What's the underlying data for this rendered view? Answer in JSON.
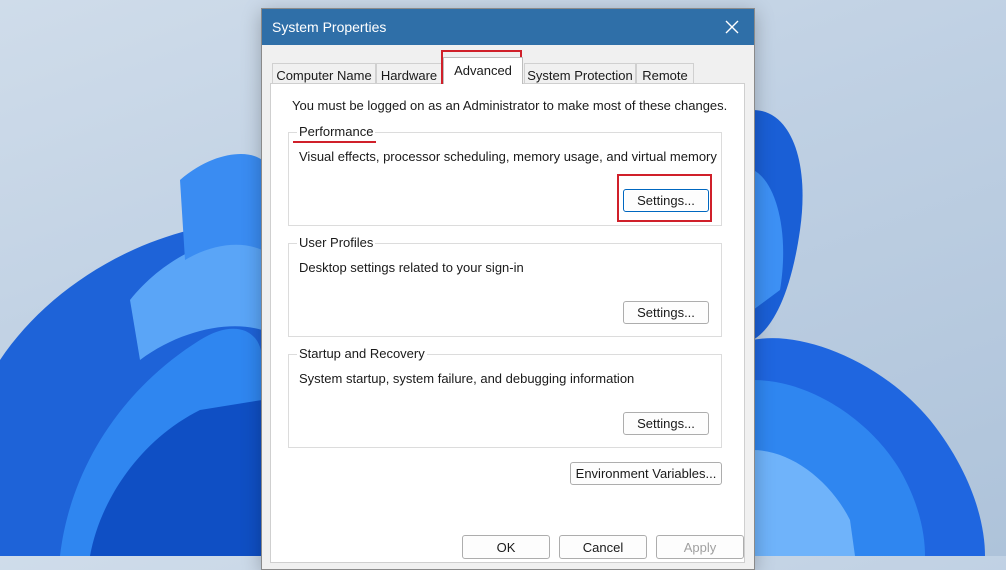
{
  "window": {
    "title": "System Properties"
  },
  "tabs": [
    {
      "label": "Computer Name"
    },
    {
      "label": "Hardware"
    },
    {
      "label": "Advanced"
    },
    {
      "label": "System Protection"
    },
    {
      "label": "Remote"
    }
  ],
  "active_tab": "Advanced",
  "admin_note": "You must be logged on as an Administrator to make most of these changes.",
  "groups": {
    "performance": {
      "title": "Performance",
      "description": "Visual effects, processor scheduling, memory usage, and virtual memory",
      "button": "Settings..."
    },
    "user_profiles": {
      "title": "User Profiles",
      "description": "Desktop settings related to your sign-in",
      "button": "Settings..."
    },
    "startup_recovery": {
      "title": "Startup and Recovery",
      "description": "System startup, system failure, and debugging information",
      "button": "Settings..."
    }
  },
  "env_button": "Environment Variables...",
  "footer": {
    "ok": "OK",
    "cancel": "Cancel",
    "apply": "Apply"
  },
  "colors": {
    "titlebar": "#2f6fa8",
    "highlight": "#d0202a",
    "wallpaper_bloom": "#1a6fe0"
  }
}
